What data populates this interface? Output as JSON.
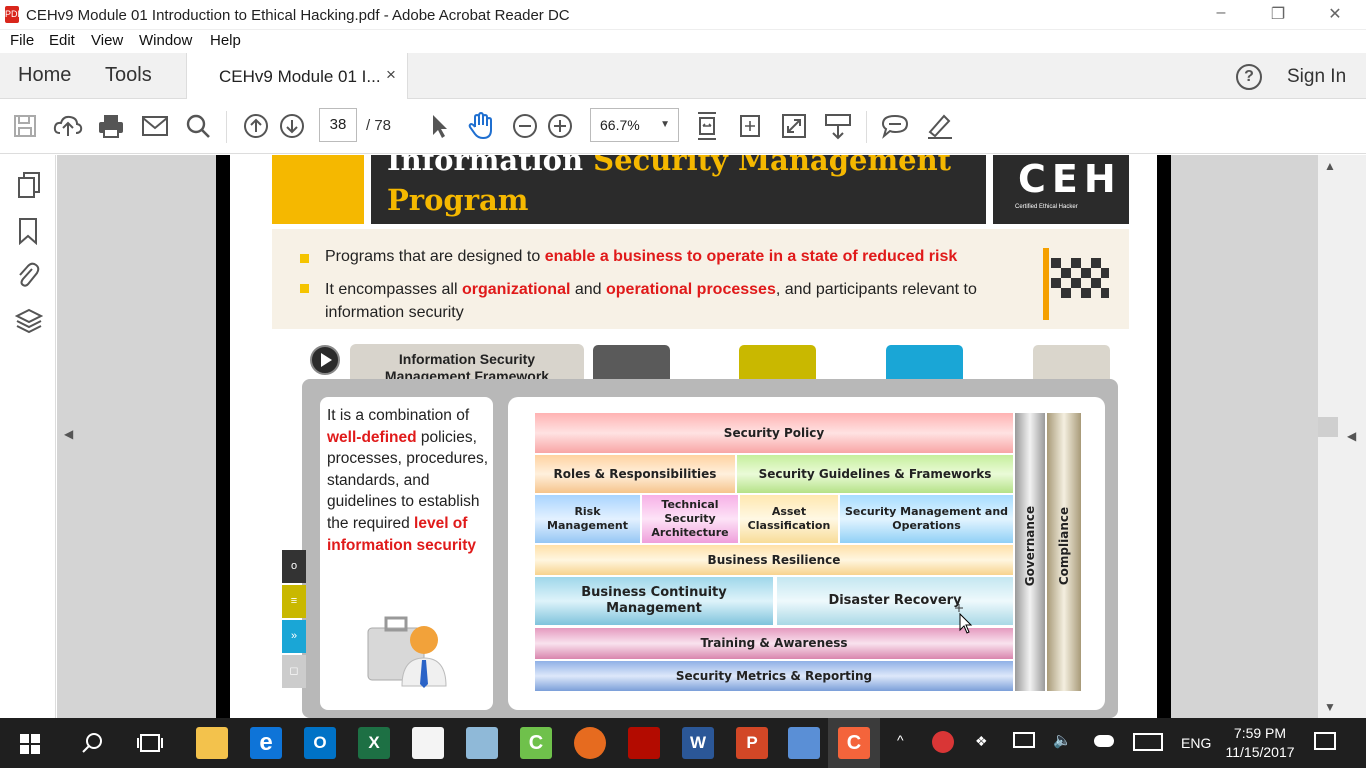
{
  "window": {
    "title": "CEHv9 Module 01 Introduction to Ethical Hacking.pdf - Adobe Acrobat Reader DC",
    "pdf_icon": "PDF"
  },
  "menu": [
    "File",
    "Edit",
    "View",
    "Window",
    "Help"
  ],
  "tabs": {
    "home": "Home",
    "tools": "Tools",
    "document": "CEHv9 Module 01 I...",
    "close": "×",
    "sign_in": "Sign In"
  },
  "toolbar": {
    "page_current": "38",
    "page_total": "/ 78",
    "zoom": "66.7%"
  },
  "slide": {
    "title_part1": "Information ",
    "title_part2": "Security Management",
    "title_line2": "Program",
    "logo": "CEH",
    "logo_sub": "Certified   Ethical   Hacker",
    "bullet1_a": "Programs that are designed to ",
    "bullet1_b": "enable a business to operate in a state of reduced risk",
    "bullet2_a": "It encompasses all ",
    "bullet2_b": "organizational",
    "bullet2_c": " and ",
    "bullet2_d": "operational processes",
    "bullet2_e": ", and participants relevant to information security",
    "framework_tab": "Information Security Management Framework",
    "desc_a": "It is a combination of ",
    "desc_b": "well-defined",
    "desc_c": " policies, processes, procedures, standards, and guidelines to establish the required ",
    "desc_d": "level of information security",
    "layers": {
      "policy": "Security Policy",
      "roles": "Roles & Responsibilities",
      "guidelines": "Security Guidelines & Frameworks",
      "risk": "Risk Management",
      "tech": "Technical Security Architecture",
      "asset": "Asset Classification",
      "smo": "Security Management and Operations",
      "resilience": "Business Resilience",
      "bcm": "Business Continuity Management",
      "dr": "Disaster Recovery",
      "training": "Training & Awareness",
      "metrics": "Security Metrics & Reporting",
      "governance": "Governance",
      "compliance": "Compliance"
    },
    "side_icons": [
      "o",
      "≡",
      "»",
      "◻"
    ]
  },
  "taskbar": {
    "language": "ENG",
    "time": "7:59 PM",
    "date": "11/15/2017"
  }
}
